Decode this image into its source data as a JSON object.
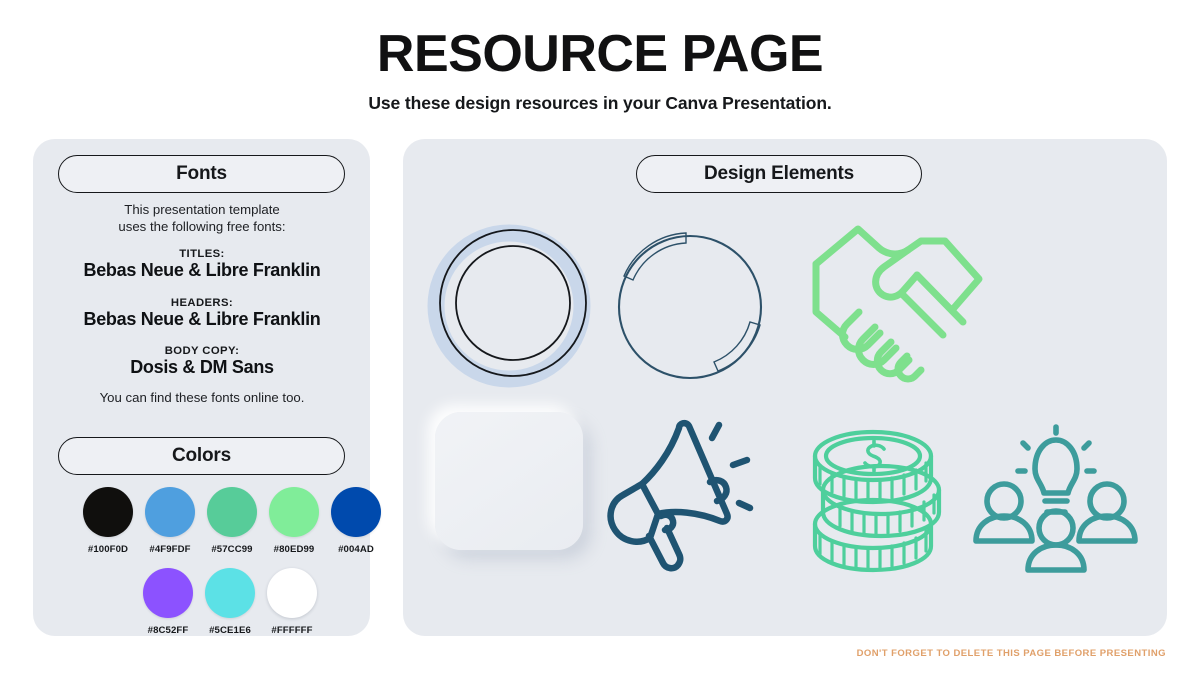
{
  "header": {
    "title": "RESOURCE PAGE",
    "subtitle": "Use these design resources in your Canva Presentation."
  },
  "fonts_panel": {
    "pill_label": "Fonts",
    "intro_line_1": "This presentation template",
    "intro_line_2": "uses the following free fonts:",
    "groups": [
      {
        "label": "TITLES:",
        "value": "Bebas Neue & Libre Franklin"
      },
      {
        "label": "HEADERS:",
        "value": "Bebas Neue & Libre Franklin"
      },
      {
        "label": "BODY COPY:",
        "value": "Dosis & DM Sans"
      }
    ],
    "outro": "You can find these fonts online too."
  },
  "colors_panel": {
    "pill_label": "Colors",
    "row_1": [
      {
        "hex": "#100F0D",
        "label": "#100F0D"
      },
      {
        "hex": "#4F9FDF",
        "label": "#4F9FDF"
      },
      {
        "hex": "#57CC99",
        "label": "#57CC99"
      },
      {
        "hex": "#80ED99",
        "label": "#80ED99"
      },
      {
        "hex": "#004AAD",
        "label": "#004AD"
      }
    ],
    "row_2": [
      {
        "hex": "#8C52FF",
        "label": "#8C52FF"
      },
      {
        "hex": "#5CE1E6",
        "label": "#5CE1E6"
      },
      {
        "hex": "#FFFFFF",
        "label": "#FFFFFF"
      }
    ]
  },
  "design_panel": {
    "pill_label": "Design Elements",
    "elements": [
      {
        "name": "ring-graphic",
        "style": "outlined-ring",
        "color": "#c9d7ea"
      },
      {
        "name": "arc-circle-graphic",
        "style": "circle-with-arcs",
        "color": "#2d5169"
      },
      {
        "name": "handshake-icon",
        "style": "line-icon",
        "color": "#7ee08d"
      },
      {
        "name": "soft-square-graphic",
        "style": "neumorphic-square",
        "color": "#edf0f4"
      },
      {
        "name": "megaphone-icon",
        "style": "line-icon",
        "color": "#1f5472"
      },
      {
        "name": "coins-stack-icon",
        "style": "line-icon",
        "color": "#4ecf9c"
      },
      {
        "name": "team-idea-icon",
        "style": "line-icon",
        "color": "#3d9c9c"
      }
    ]
  },
  "footer": {
    "note": "DON'T FORGET TO DELETE THIS PAGE BEFORE PRESENTING",
    "color": "#e0a06a"
  },
  "theme": {
    "panel_bg": "#e7eaef",
    "page_bg": "#ffffff",
    "ink": "#16181b"
  }
}
